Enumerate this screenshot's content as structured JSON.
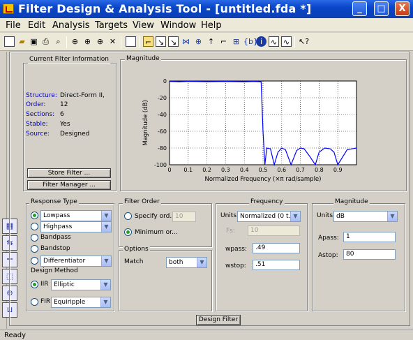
{
  "window": {
    "title": "Filter Design & Analysis Tool -  [untitled.fda *]",
    "minimize_glyph": "_",
    "maximize_glyph": "□",
    "close_glyph": "X"
  },
  "menu": [
    "File",
    "Edit",
    "Analysis",
    "Targets",
    "View",
    "Window",
    "Help"
  ],
  "toolbar_icons": [
    "new-icon",
    "open-icon",
    "save-icon",
    "print-icon",
    "print-preview-icon",
    "zoom-in-icon",
    "zoom-x-icon",
    "zoom-y-icon",
    "full-view-icon",
    "new-window-icon",
    "magnitude-response-icon",
    "phase-response-icon",
    "magnitude-phase-icon",
    "group-delay-icon",
    "phase-delay-icon",
    "impulse-response-icon",
    "step-response-icon",
    "pole-zero-icon",
    "filter-coefficients-icon",
    "filter-info-icon",
    "magnitude-estimate-icon",
    "round-off-noise-icon",
    "whats-this-icon"
  ],
  "current_filter": {
    "title": "Current Filter Information",
    "rows": [
      {
        "label": "Structure:",
        "value": "Direct-Form II,"
      },
      {
        "label": "Order:",
        "value": "12"
      },
      {
        "label": "Sections:",
        "value": "6"
      },
      {
        "label": "Stable:",
        "value": "Yes"
      },
      {
        "label": "Source:",
        "value": "Designed"
      }
    ],
    "store_button": "Store Filter ...",
    "manager_button": "Filter Manager ..."
  },
  "plot": {
    "panel_title": "Magnitude",
    "ylabel": "Magnitude (dB)",
    "xlabel": "Normalized Frequency (×π rad/sample)",
    "yticks": [
      "0",
      "-20",
      "-40",
      "-60",
      "-80",
      "-100"
    ],
    "xticks": [
      "0",
      "0.1",
      "0.2",
      "0.3",
      "0.4",
      "0.5",
      "0.6",
      "0.7",
      "0.8",
      "0.9"
    ],
    "line_color": "#0000ff"
  },
  "chart_data": {
    "type": "line",
    "xlabel": "Normalized Frequency (×π rad/sample)",
    "ylabel": "Magnitude (dB)",
    "xlim": [
      0,
      1
    ],
    "ylim": [
      -100,
      0
    ],
    "grid": true,
    "series": [
      {
        "x": [
          0,
          0.05,
          0.1,
          0.2,
          0.3,
          0.4,
          0.45,
          0.49,
          0.5,
          0.51,
          0.52,
          0.54,
          0.56,
          0.58,
          0.6,
          0.62,
          0.65,
          0.68,
          0.7,
          0.72,
          0.75,
          0.78,
          0.8,
          0.83,
          0.86,
          0.88,
          0.9,
          0.95,
          1.0
        ],
        "y": [
          -0.5,
          -0.9,
          -0.4,
          -0.8,
          -0.5,
          -0.9,
          -0.5,
          -1,
          -60,
          -100,
          -80,
          -81,
          -100,
          -85,
          -80,
          -82,
          -100,
          -83,
          -80,
          -81,
          -90,
          -100,
          -85,
          -80,
          -81,
          -85,
          -100,
          -82,
          -80
        ]
      }
    ]
  },
  "response_type": {
    "title": "Response Type",
    "options": [
      {
        "label": "Lowpass",
        "selected": true,
        "dropdown": "Lowpass"
      },
      {
        "label": "",
        "selected": false,
        "dropdown": "Highpass"
      },
      {
        "label": "Bandpass",
        "selected": false
      },
      {
        "label": "Bandstop",
        "selected": false
      },
      {
        "label": "",
        "selected": false,
        "dropdown": "Differentiator"
      }
    ]
  },
  "design_method": {
    "title": "Design Method",
    "iir_label": "IIR",
    "iir_value": "Elliptic",
    "fir_label": "FIR",
    "fir_value": "Equiripple"
  },
  "filter_order": {
    "title": "Filter Order",
    "specify_label": "Specify ord...",
    "specify_value": "10",
    "minimum_label": "Minimum or..."
  },
  "options": {
    "title": "Options",
    "match_label": "Match",
    "match_value": "both"
  },
  "frequency": {
    "title": "Frequency",
    "units_label": "Units:",
    "units_value": "Normalized (0 t...",
    "fs_label": "Fs:",
    "fs_value": "10",
    "wpass_label": "wpass:",
    "wpass_value": ".49",
    "wstop_label": "wstop:",
    "wstop_value": ".51"
  },
  "magnitude_specs": {
    "title": "Magnitude",
    "units_label": "Units:",
    "units_value": "dB",
    "apass_label": "Apass:",
    "apass_value": "1",
    "astop_label": "Astop:",
    "astop_value": "80"
  },
  "design_button": "Design Filter",
  "status": "Ready"
}
